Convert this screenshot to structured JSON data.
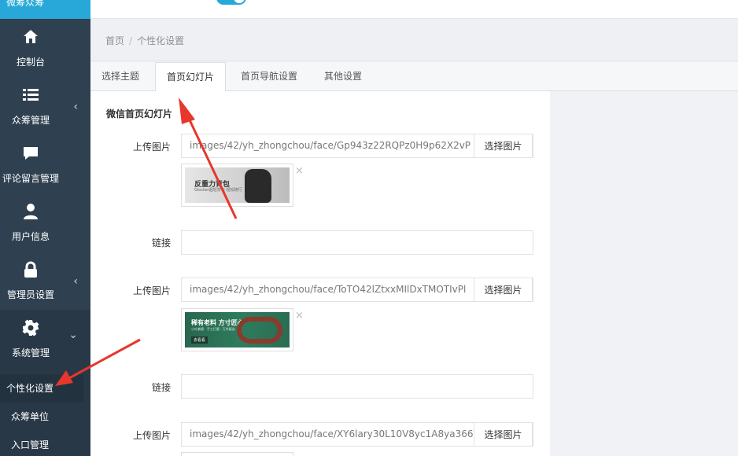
{
  "sidebar": {
    "brand": "微筹众筹",
    "items": [
      {
        "label": "控制台",
        "icon": "home-icon",
        "has_chevron": false
      },
      {
        "label": "众筹管理",
        "icon": "list-icon",
        "has_chevron": true
      },
      {
        "label": "评论留言管理",
        "icon": "chat-icon",
        "has_chevron": false
      },
      {
        "label": "用户信息",
        "icon": "user-icon",
        "has_chevron": false
      },
      {
        "label": "管理员设置",
        "icon": "lock-icon",
        "has_chevron": true
      },
      {
        "label": "系统管理",
        "icon": "gear-icon",
        "has_chevron": true
      }
    ],
    "subitems": [
      {
        "label": "个性化设置",
        "active": true
      },
      {
        "label": "众筹单位",
        "active": false
      },
      {
        "label": "入口管理",
        "active": false
      }
    ],
    "chevron_left": "‹",
    "chevron_down": "⌄"
  },
  "breadcrumb": {
    "home": "首页",
    "separator": "/",
    "current": "个性化设置"
  },
  "tabs": [
    {
      "label": "选择主题",
      "active": false
    },
    {
      "label": "首页幻灯片",
      "active": true
    },
    {
      "label": "首页导航设置",
      "active": false
    },
    {
      "label": "其他设置",
      "active": false
    }
  ],
  "panel": {
    "section_title": "微信首页幻灯片",
    "upload_label": "上传图片",
    "link_label": "链接",
    "choose_button": "选择图片",
    "remove_mark": "×",
    "slides": [
      {
        "image_path": "images/42/yh_zhongchou/face/Gp943z22RQPz0H9p62X2vP",
        "thumb_title": "反重力背包",
        "thumb_subtitle": "Glocker超轻背包 轻松随行",
        "link": ""
      },
      {
        "image_path": "images/42/yh_zhongchou/face/ToTO42lZtxxMIlDxTMOTIvPl",
        "thumb_title": "稀有老料 方寸匠心",
        "thumb_subtitle": "小叶紫檀 · 手工打磨 · 万件精选",
        "thumb_button": "去看看",
        "link": ""
      },
      {
        "image_path": "images/42/yh_zhongchou/face/XY6lary30L10V8yc1A8ya366"
      }
    ]
  },
  "colors": {
    "sidebar_bg": "#2f4050",
    "accent": "#27a8d8",
    "annotation_red": "#e8362d"
  }
}
